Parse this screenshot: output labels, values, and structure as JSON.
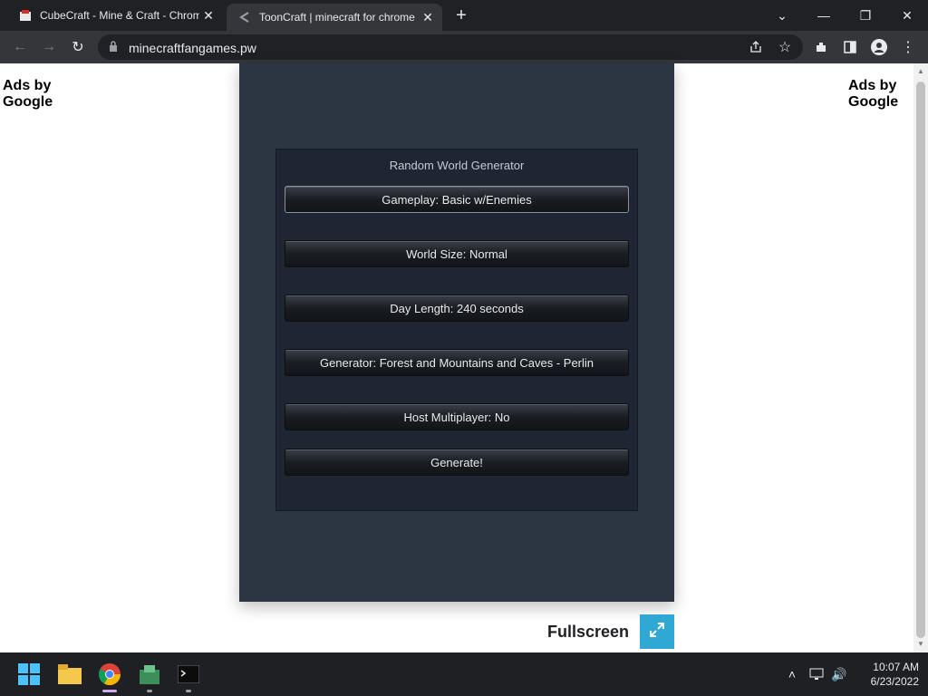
{
  "browser": {
    "tabs": [
      {
        "title": "CubeCraft - Mine & Craft - Chrom",
        "active": false
      },
      {
        "title": "ToonCraft | minecraft for chrome",
        "active": true
      }
    ],
    "url": "minecraftfangames.pw"
  },
  "page": {
    "ads_left": "Ads by Google",
    "ads_right": "Ads by Google",
    "panel_title": "Random World Generator",
    "options": [
      {
        "label": "Gameplay: Basic w/Enemies"
      },
      {
        "label": "World Size: Normal"
      },
      {
        "label": "Day Length: 240 seconds"
      },
      {
        "label": "Generator: Forest and Mountains and Caves - Perlin"
      },
      {
        "label": "Host Multiplayer: No"
      }
    ],
    "generate_label": "Generate!",
    "fullscreen_label": "Fullscreen"
  },
  "taskbar": {
    "time": "10:07 AM",
    "date": "6/23/2022"
  },
  "colors": {
    "game_bg": "#2c3643",
    "panel_bg": "#1f2633",
    "fullscreen_accent": "#2fa8d4"
  }
}
